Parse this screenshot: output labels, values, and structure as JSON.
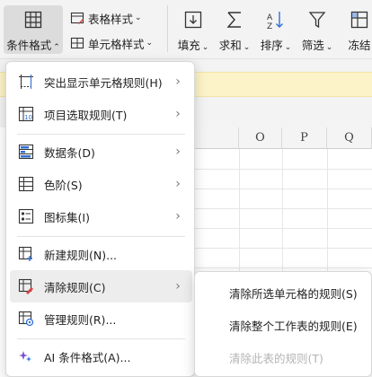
{
  "ribbon": {
    "conditional_format": "条件格式",
    "table_style": "表格样式",
    "cell_style": "单元格样式",
    "fill": "填充",
    "sum": "求和",
    "sort": "排序",
    "filter": "筛选",
    "freeze": "冻结"
  },
  "sheet": {
    "columns": [
      "O",
      "P",
      "Q"
    ]
  },
  "menu": {
    "items": [
      {
        "label": "突出显示单元格规则(H)",
        "icon": "highlight-rules-icon",
        "has_submenu": true
      },
      {
        "label": "项目选取规则(T)",
        "icon": "top-bottom-rules-icon",
        "has_submenu": true
      },
      {
        "label": "数据条(D)",
        "icon": "data-bars-icon",
        "has_submenu": true
      },
      {
        "label": "色阶(S)",
        "icon": "color-scales-icon",
        "has_submenu": true
      },
      {
        "label": "图标集(I)",
        "icon": "icon-sets-icon",
        "has_submenu": true
      },
      {
        "label": "新建规则(N)...",
        "icon": "new-rule-icon",
        "has_submenu": false
      },
      {
        "label": "清除规则(C)",
        "icon": "clear-rules-icon",
        "has_submenu": true,
        "active": true
      },
      {
        "label": "管理规则(R)...",
        "icon": "manage-rules-icon",
        "has_submenu": false
      },
      {
        "label": "AI 条件格式(A)...",
        "icon": "ai-format-icon",
        "has_submenu": false
      }
    ]
  },
  "submenu": {
    "items": [
      {
        "label": "清除所选单元格的规则(S)",
        "disabled": false
      },
      {
        "label": "清除整个工作表的规则(E)",
        "disabled": false
      },
      {
        "label": "清除此表的规则(T)",
        "disabled": true
      }
    ]
  },
  "colors": {
    "notification_bar": "#fdf3c8",
    "menu_hover": "#ededed",
    "accent_blue": "#2f6fd6",
    "accent_red": "#d64545"
  }
}
